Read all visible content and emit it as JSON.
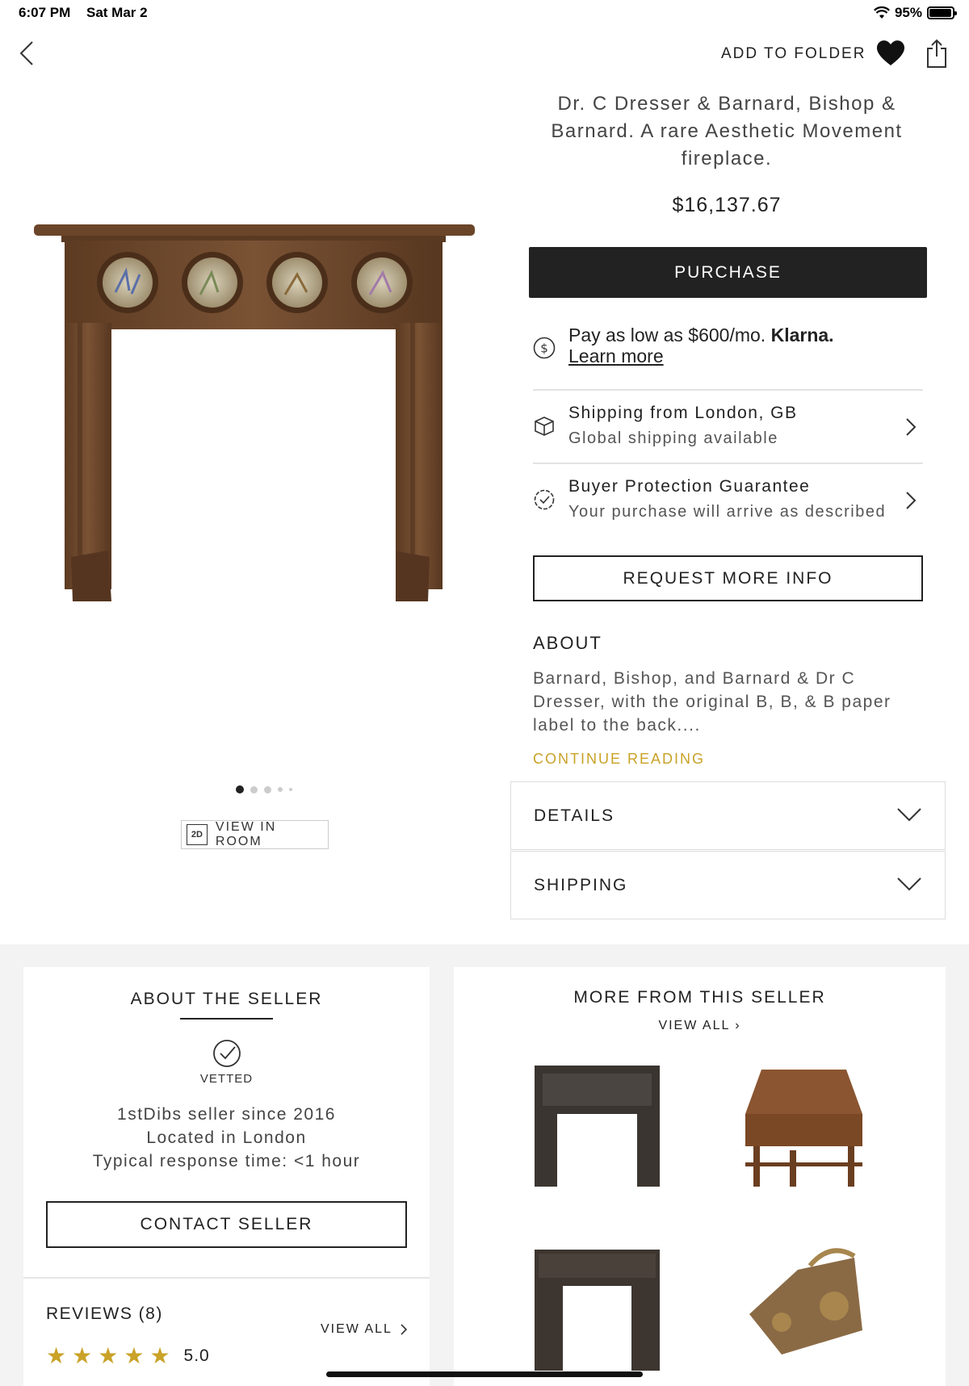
{
  "status_bar": {
    "time": "6:07 PM",
    "date": "Sat Mar 2",
    "battery": "95%",
    "battery_level": 0.95
  },
  "header": {
    "add_to_folder": "ADD TO FOLDER"
  },
  "product": {
    "title": "Dr. C Dresser & Barnard, Bishop & Barnard. A rare Aesthetic Movement fireplace.",
    "price": "$16,137.67",
    "purchase_label": "PURCHASE",
    "klarna": {
      "text": "Pay as low as $600/mo.",
      "brand": "Klarna.",
      "learn_more": "Learn more"
    },
    "shipping": {
      "title": "Shipping from London, GB",
      "subtitle": "Global shipping available"
    },
    "protection": {
      "title": "Buyer Protection Guarantee",
      "subtitle": "Your purchase will arrive as described"
    },
    "request_info": "REQUEST MORE INFO",
    "about": {
      "heading": "ABOUT",
      "body": "Barnard, Bishop, and Barnard & Dr C Dresser, with the original B, B, & B paper label to the back....",
      "continue": "CONTINUE READING"
    },
    "accordions": [
      {
        "label": "DETAILS"
      },
      {
        "label": "SHIPPING"
      }
    ]
  },
  "gallery": {
    "view_in_room": "VIEW IN ROOM",
    "badge": "2D",
    "dots_total": 5,
    "active_dot": 0
  },
  "seller": {
    "heading": "ABOUT THE SELLER",
    "vetted": "VETTED",
    "since": "1stDibs seller since 2016",
    "location": "Located in London",
    "response": "Typical response time: <1 hour",
    "contact": "CONTACT SELLER",
    "reviews_heading": "REVIEWS (8)",
    "reviews_view_all": "VIEW ALL",
    "rating": "5.0",
    "stars": 5
  },
  "more_from_seller": {
    "heading": "MORE FROM THIS SELLER",
    "view_all": "VIEW ALL"
  },
  "colors": {
    "accent_gold": "#c9a227",
    "button_dark": "#222222"
  }
}
